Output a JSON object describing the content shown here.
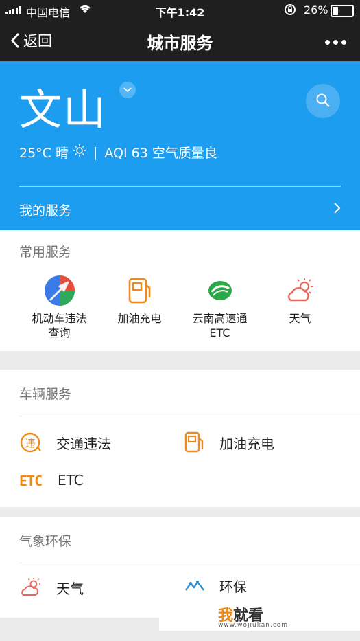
{
  "status_bar": {
    "carrier": "中国电信",
    "time": "下午1:42",
    "battery": "26%"
  },
  "nav": {
    "back_label": "返回",
    "title": "城市服务"
  },
  "hero": {
    "city": "文山",
    "weather_temp": "25°C 晴",
    "weather_aqi": "AQI 63 空气质量良",
    "my_service": "我的服务"
  },
  "common": {
    "title": "常用服务",
    "items": [
      {
        "label": "机动车违法查询",
        "icon": "traffic-violation-icon"
      },
      {
        "label": "加油充电",
        "icon": "fuel-pump-icon"
      },
      {
        "label": "云南高速通\nETC",
        "icon": "yunnan-expressway-icon"
      },
      {
        "label": "天气",
        "icon": "weather-icon"
      }
    ]
  },
  "vehicle": {
    "title": "车辆服务",
    "items": [
      {
        "label": "交通违法"
      },
      {
        "label": "加油充电"
      },
      {
        "label": "ETC"
      }
    ]
  },
  "eco": {
    "title": "气象环保",
    "items": [
      {
        "label": "天气"
      },
      {
        "label": "环保"
      }
    ]
  },
  "watermark": {
    "brand_a": "我",
    "brand_b": "就看",
    "url": "www.wojiukan.com"
  },
  "colors": {
    "hero_bg": "#1d9df0",
    "accent_orange": "#ef8a1a",
    "weather_red": "#e8665a"
  }
}
